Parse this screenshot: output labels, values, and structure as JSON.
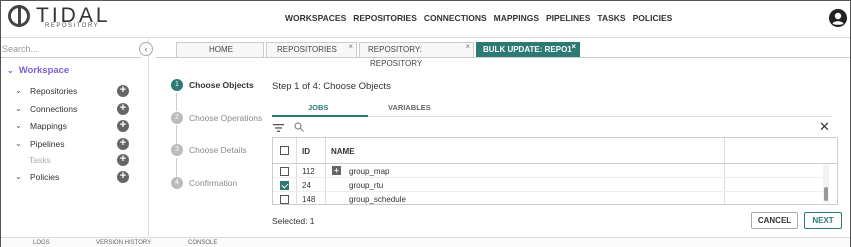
{
  "logo": {
    "name": "TIDAL",
    "sub": "REPOSITORY"
  },
  "topnav": [
    "WORKSPACES",
    "REPOSITORIES",
    "CONNECTIONS",
    "MAPPINGS",
    "PIPELINES",
    "TASKS",
    "POLICIES"
  ],
  "sidebar": {
    "search_placeholder": "Search...",
    "workspace": "Workspace",
    "items": [
      {
        "label": "Repositories"
      },
      {
        "label": "Connections"
      },
      {
        "label": "Mappings"
      },
      {
        "label": "Pipelines"
      },
      {
        "label": "Tasks"
      },
      {
        "label": "Policies"
      }
    ]
  },
  "bottombar": [
    "LOGS",
    "VERSION HISTORY",
    "CONSOLE"
  ],
  "tabs": [
    {
      "label": "HOME"
    },
    {
      "label": "REPOSITORIES"
    },
    {
      "label": "REPOSITORY: REPOSITORY"
    },
    {
      "label": "BULK UPDATE: REPO1"
    }
  ],
  "steps": [
    {
      "num": "1",
      "label": "Choose Objects"
    },
    {
      "num": "2",
      "label": "Choose Operations"
    },
    {
      "num": "3",
      "label": "Choose Details"
    },
    {
      "num": "4",
      "label": "Confirmation"
    }
  ],
  "step_title": "Step 1 of 4: Choose Objects",
  "subtabs": [
    "JOBS",
    "VARIABLES"
  ],
  "grid": {
    "headers": {
      "id": "ID",
      "name": "NAME"
    },
    "rows": [
      {
        "id": "112",
        "name": "group_map",
        "checked": false
      },
      {
        "id": "24",
        "name": "group_rtu",
        "checked": true
      },
      {
        "id": "148",
        "name": "group_schedule",
        "checked": false
      }
    ]
  },
  "selected_text": "Selected: 1",
  "buttons": {
    "cancel": "CANCEL",
    "next": "NEXT"
  },
  "colors": {
    "accent": "#2c7a72",
    "workspace": "#7c5fd0"
  }
}
